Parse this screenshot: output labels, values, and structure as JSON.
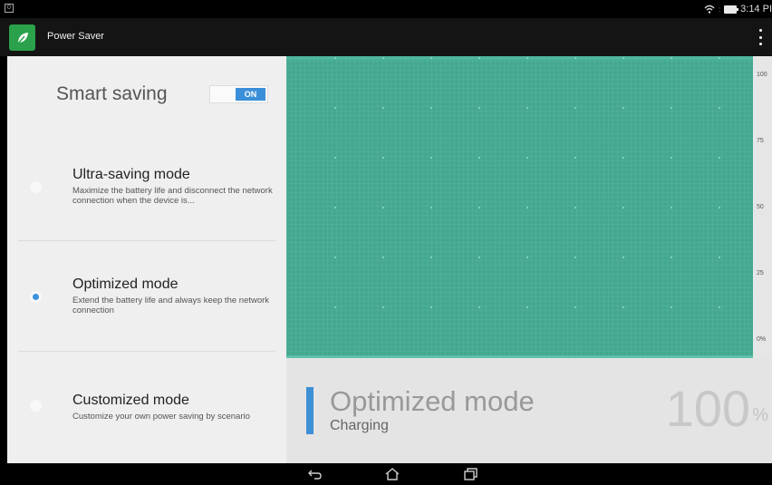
{
  "status_bar": {
    "left_icon": "notification-icon",
    "left_icon_text": "0",
    "wifi_icon": "wifi-icon",
    "battery_icon": "battery-icon",
    "time": "3:14 PI"
  },
  "app_bar": {
    "title": "Power Saver",
    "logo_icon": "leaf-icon",
    "menu_icon": "overflow-menu-icon"
  },
  "smart_saving": {
    "label": "Smart saving",
    "toggle_state": "ON"
  },
  "modes": [
    {
      "title": "Ultra-saving mode",
      "description": "Maximize the battery life and disconnect the network connection when the device is...",
      "selected": false
    },
    {
      "title": "Optimized mode",
      "description": "Extend the battery life and always keep the network connection",
      "selected": true
    },
    {
      "title": "Customized mode",
      "description": "Customize your own power saving by scenario",
      "selected": false
    }
  ],
  "chart_data": {
    "type": "area",
    "y_ticks": [
      "100",
      "75",
      "50",
      "25",
      "0%"
    ],
    "ylim": [
      0,
      100
    ],
    "values": [
      100
    ],
    "colors": {
      "fill": "#44a891",
      "dots": "#7fd0bb"
    }
  },
  "summary": {
    "mode": "Optimized mode",
    "status": "Charging",
    "percent": "100",
    "unit": "%"
  },
  "nav_bar": {
    "back_icon": "back-icon",
    "home_icon": "home-icon",
    "recents_icon": "recents-icon"
  },
  "colors": {
    "accent": "#3d8fd6",
    "chart_green": "#44a891",
    "app_green": "#2aa14a"
  }
}
